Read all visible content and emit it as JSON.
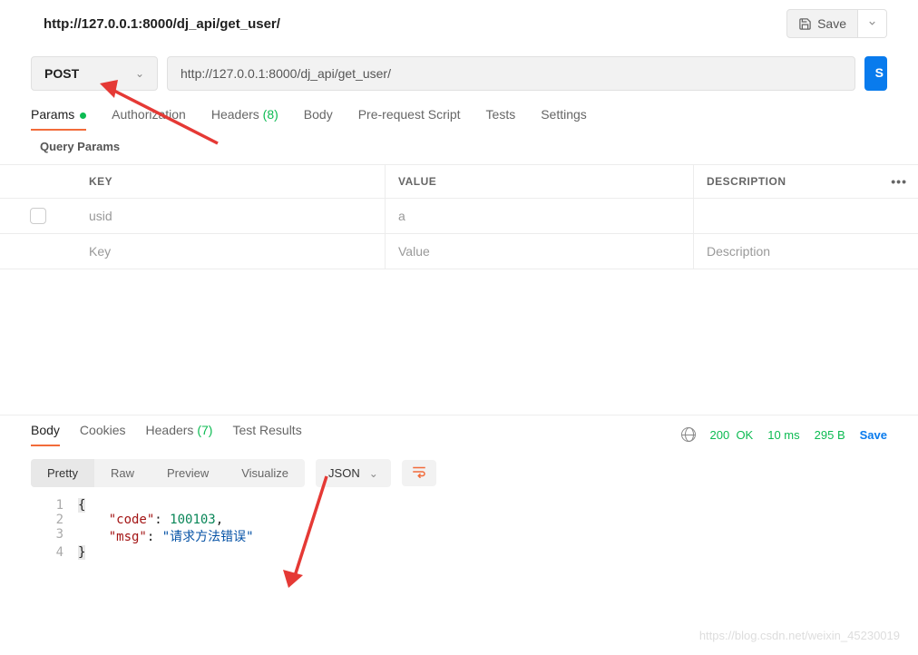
{
  "header": {
    "title": "http://127.0.0.1:8000/dj_api/get_user/",
    "save_label": "Save"
  },
  "request": {
    "method": "POST",
    "url": "http://127.0.0.1:8000/dj_api/get_user/",
    "send_label": "S"
  },
  "req_tabs": {
    "params": "Params",
    "auth": "Authorization",
    "headers": "Headers",
    "headers_count": "(8)",
    "body": "Body",
    "prereq": "Pre-request Script",
    "tests": "Tests",
    "settings": "Settings"
  },
  "query": {
    "title": "Query Params",
    "cols": {
      "key": "KEY",
      "value": "VALUE",
      "desc": "DESCRIPTION"
    },
    "rows": [
      {
        "key": "usid",
        "value": "a",
        "desc": ""
      }
    ],
    "placeholder": {
      "key": "Key",
      "value": "Value",
      "desc": "Description"
    }
  },
  "resp_tabs": {
    "body": "Body",
    "cookies": "Cookies",
    "headers": "Headers",
    "headers_count": "(7)",
    "test_results": "Test Results"
  },
  "status": {
    "code": "200",
    "text": "OK",
    "time": "10 ms",
    "size": "295 B",
    "save": "Save"
  },
  "view": {
    "pretty": "Pretty",
    "raw": "Raw",
    "preview": "Preview",
    "visualize": "Visualize",
    "format": "JSON"
  },
  "response_json": {
    "code": 100103,
    "msg": "请求方法错误"
  },
  "watermark": "https://blog.csdn.net/weixin_45230019"
}
